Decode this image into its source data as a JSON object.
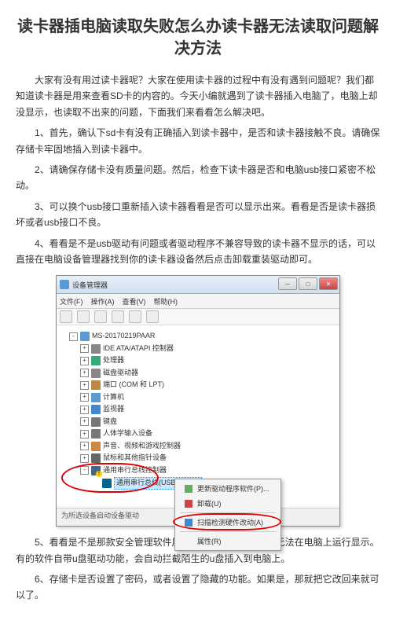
{
  "title": "读卡器插电脑读取失败怎么办读卡器无法读取问题解决方法",
  "intro": "大家有没有用过读卡器呢？大家在使用读卡器的过程中有没有遇到问题呢？我们都知道读卡器是用来查看SD卡的内容的。今天小编就遇到了读卡器插入电脑了，电脑上却没显示，也读取不出来的问题，下面我们来看看怎么解决吧。",
  "steps": {
    "s1": "1、首先，确认下sd卡有没有正确插入到读卡器中，是否和读卡器接触不良。请确保存储卡牢固地插入到读卡器中。",
    "s2": "2、请确保存储卡没有质量问题。然后，检查下读卡器是否和电脑usb接口紧密不松动。",
    "s3": "3、可以换个usb接口重新插入读卡器看看是否可以显示出来。看看是否是读卡器损坏或者usb接口不良。",
    "s4": "4、看看是不是usb驱动有问题或者驱动程序不兼容导致的读卡器不显示的话，可以直接在电脑设备管理器找到你的读卡器设备然后点击卸载重装驱动即可。",
    "s5": "5、看看是不是那款安全管理软件屏蔽了你的读卡器，使其无法在电脑上运行显示。有的软件自带u盘驱动功能，会自动拦截陌生的u盘插入到电脑上。",
    "s6": "6、存储卡是否设置了密码，或者设置了隐藏的功能。如果是，那就把它改回来就可以了。"
  },
  "devmgr": {
    "title": "设备管理器",
    "menu": {
      "file": "文件(F)",
      "action": "操作(A)",
      "view": "查看(V)",
      "help": "帮助(H)"
    },
    "root": "MS-20170219PAAR",
    "nodes": {
      "ide": "IDE ATA/ATAPI 控制器",
      "cpu": "处理器",
      "disk": "磁盘驱动器",
      "port": "端口 (COM 和 LPT)",
      "pc": "计算机",
      "mon": "监视器",
      "kb": "键盘",
      "hid": "人体学输入设备",
      "snd": "声音、视频和游戏控制器",
      "mouse": "鼠标和其他指针设备",
      "usbctrl": "通用串行总线控制器",
      "usbhub": "通用串行总线(USB)集线器"
    },
    "ctx": {
      "update": "更新驱动程序软件(P)...",
      "uninstall": "卸载(U)",
      "scan": "扫描检测硬件改动(A)",
      "props": "属性(R)"
    },
    "status": "为所选设备启动设备驱动"
  }
}
